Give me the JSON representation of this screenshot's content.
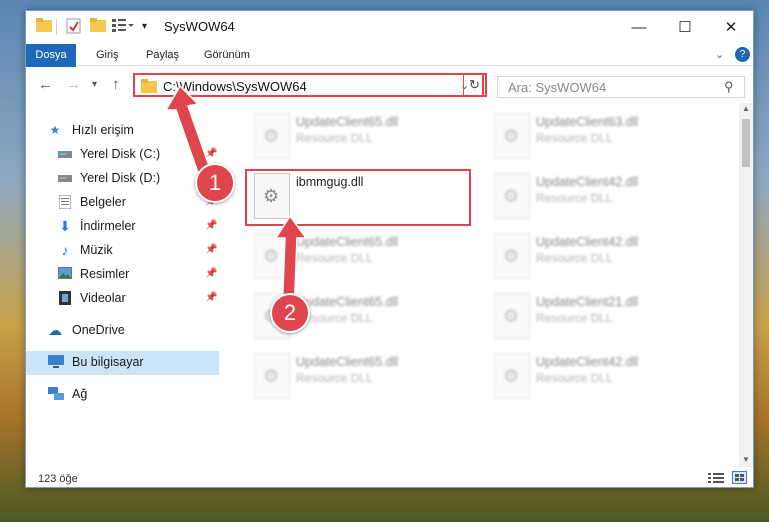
{
  "window": {
    "title": "SysWOW64",
    "controls": {
      "minimize": "—",
      "maximize": "☐",
      "close": "✕"
    }
  },
  "ribbon": {
    "tabs": [
      "Dosya",
      "Giriş",
      "Paylaş",
      "Görünüm"
    ]
  },
  "address": {
    "path": "C:\\Windows\\SysWOW64",
    "search_placeholder": "Ara: SysWOW64"
  },
  "nav": {
    "quick_access": "Hızlı erişim",
    "items": [
      {
        "label": "Yerel Disk (C:)",
        "icon": "drive-icon",
        "pinned": true
      },
      {
        "label": "Yerel Disk (D:)",
        "icon": "drive-icon",
        "pinned": false
      },
      {
        "label": "Belgeler",
        "icon": "documents-icon",
        "pinned": true
      },
      {
        "label": "İndirmeler",
        "icon": "download-icon",
        "pinned": true
      },
      {
        "label": "Müzik",
        "icon": "music-icon",
        "pinned": true
      },
      {
        "label": "Resimler",
        "icon": "pictures-icon",
        "pinned": true
      },
      {
        "label": "Videolar",
        "icon": "videos-icon",
        "pinned": true
      }
    ],
    "onedrive": "OneDrive",
    "this_pc": "Bu bilgisayar",
    "network": "Ağ"
  },
  "files": {
    "left": [
      {
        "name": "UpdateClient65.dll",
        "type": "Resource DLL"
      },
      {
        "name": "ibmmgug.dll",
        "type": ""
      },
      {
        "name": "UpdateClient65.dll",
        "type": "Resource DLL"
      },
      {
        "name": "UpdateClient65.dll",
        "type": "Resource DLL"
      },
      {
        "name": "UpdateClient65.dll",
        "type": "Resource DLL"
      }
    ],
    "right": [
      {
        "name": "UpdateClient63.dll",
        "type": "Resource DLL"
      },
      {
        "name": "UpdateClient42.dll",
        "type": "Resource DLL"
      },
      {
        "name": "UpdateClient42.dll",
        "type": "Resource DLL"
      },
      {
        "name": "UpdateClient21.dll",
        "type": "Resource DLL"
      },
      {
        "name": "UpdateClient42.dll",
        "type": "Resource DLL"
      }
    ]
  },
  "status": {
    "count": "123 öğe"
  },
  "annotations": {
    "step1": "1",
    "step2": "2",
    "color": "#e0454d"
  }
}
